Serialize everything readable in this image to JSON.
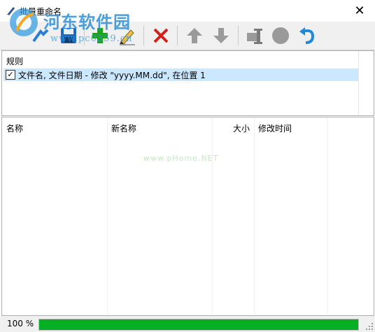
{
  "window": {
    "title": "批量重命名"
  },
  "watermark": {
    "title": "河东软件园",
    "url": "www.pc0359.cn",
    "url2": "www.pHome.NET"
  },
  "toolbar": {
    "buttons": [
      {
        "name": "open-icon"
      },
      {
        "name": "save-icon"
      },
      {
        "name": "add-rule-icon"
      },
      {
        "name": "edit-rule-icon"
      },
      {
        "name": "delete-rule-icon"
      },
      {
        "name": "move-up-icon"
      },
      {
        "name": "move-down-icon"
      },
      {
        "name": "preview-icon"
      },
      {
        "name": "record-icon"
      },
      {
        "name": "undo-icon"
      }
    ]
  },
  "rules": {
    "header": "规则",
    "items": [
      {
        "checked": true,
        "text": "文件名, 文件日期 - 修改 \"yyyy.MM.dd\", 在位置 1"
      }
    ]
  },
  "files": {
    "columns": [
      "名称",
      "新名称",
      "大小",
      "修改时间"
    ],
    "rows": []
  },
  "status": {
    "progress_label": "100 %",
    "progress_value": 1.0,
    "progress_color": "#06b025"
  }
}
